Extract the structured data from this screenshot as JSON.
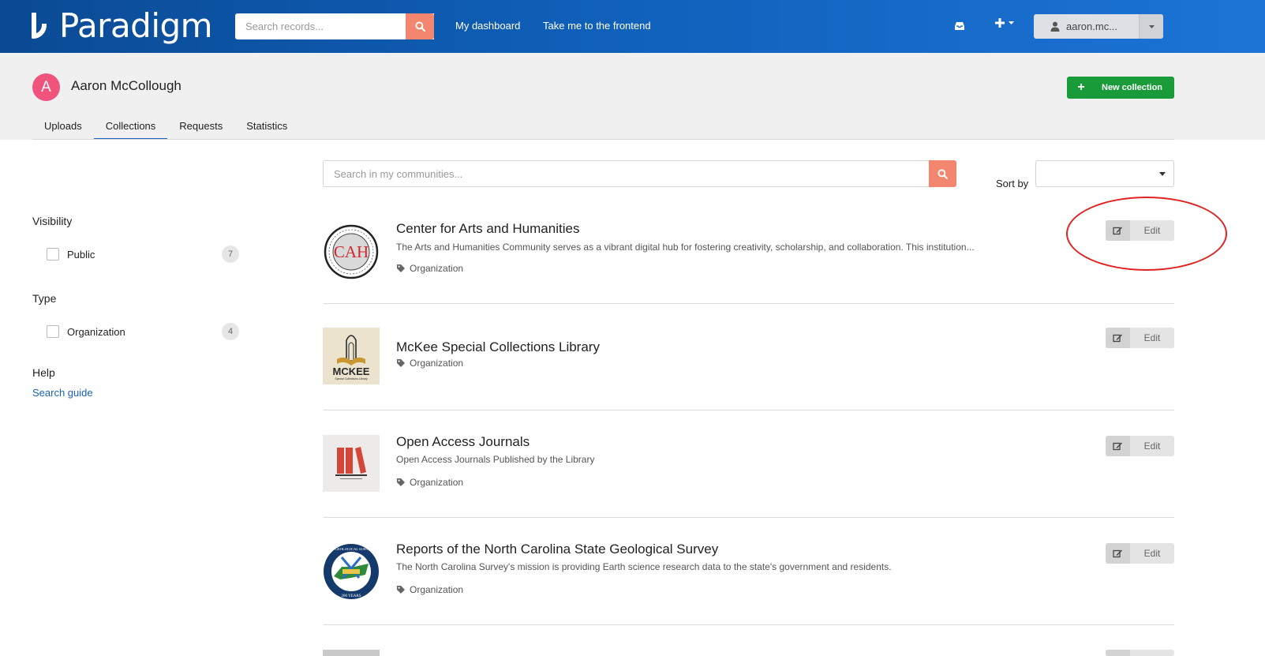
{
  "header": {
    "logo_text": "Paradigm",
    "search_placeholder": "Search records...",
    "nav": [
      "My dashboard",
      "Take me to the frontend"
    ],
    "user_label": "aaron.mc..."
  },
  "profile": {
    "avatar_letter": "A",
    "name": "Aaron McCollough",
    "new_collection_label": "New collection",
    "tabs": [
      {
        "label": "Uploads",
        "active": false
      },
      {
        "label": "Collections",
        "active": true
      },
      {
        "label": "Requests",
        "active": false
      },
      {
        "label": "Statistics",
        "active": false
      }
    ]
  },
  "filters": {
    "visibility": {
      "title": "Visibility",
      "items": [
        {
          "label": "Public",
          "count": "7"
        }
      ]
    },
    "type": {
      "title": "Type",
      "items": [
        {
          "label": "Organization",
          "count": "4"
        }
      ]
    },
    "help": {
      "title": "Help",
      "link": "Search guide"
    }
  },
  "list_controls": {
    "search_placeholder": "Search in my communities...",
    "sort_label": "Sort by",
    "sort_value": ""
  },
  "collections": [
    {
      "title": "Center for Arts and Humanities",
      "description": "The Arts and Humanities Community serves as a vibrant digital hub for fostering creativity, scholarship, and collaboration. This institution...",
      "tag": "Organization",
      "edit_label": "Edit",
      "logo": "cah-seal-logo",
      "logo_text": "CAH"
    },
    {
      "title": "McKee Special Collections Library",
      "description": "",
      "tag": "Organization",
      "edit_label": "Edit",
      "logo": "mckee-book-logo",
      "logo_text": "MCKEE",
      "logo_subtext": "Special Collections Library"
    },
    {
      "title": "Open Access Journals",
      "description": "Open Access Journals Published by the Library",
      "tag": "Organization",
      "edit_label": "Edit",
      "logo": "red-books-logo"
    },
    {
      "title": "Reports of the North Carolina State Geological Survey",
      "description": "The North Carolina Survey's mission is providing Earth science research data to the state's government and residents.",
      "tag": "Organization",
      "edit_label": "Edit",
      "logo": "nc-geological-survey-seal",
      "logo_text": "NC GEOLOGICAL SURVEY",
      "logo_subtext": "200 YEARS"
    }
  ],
  "colors": {
    "header_blue": "#0f5fb8",
    "accent_orange": "#f3866e",
    "avatar_pink": "#f0537c",
    "new_collection_green": "#1a9b3a",
    "annotation_red": "#e02222"
  }
}
